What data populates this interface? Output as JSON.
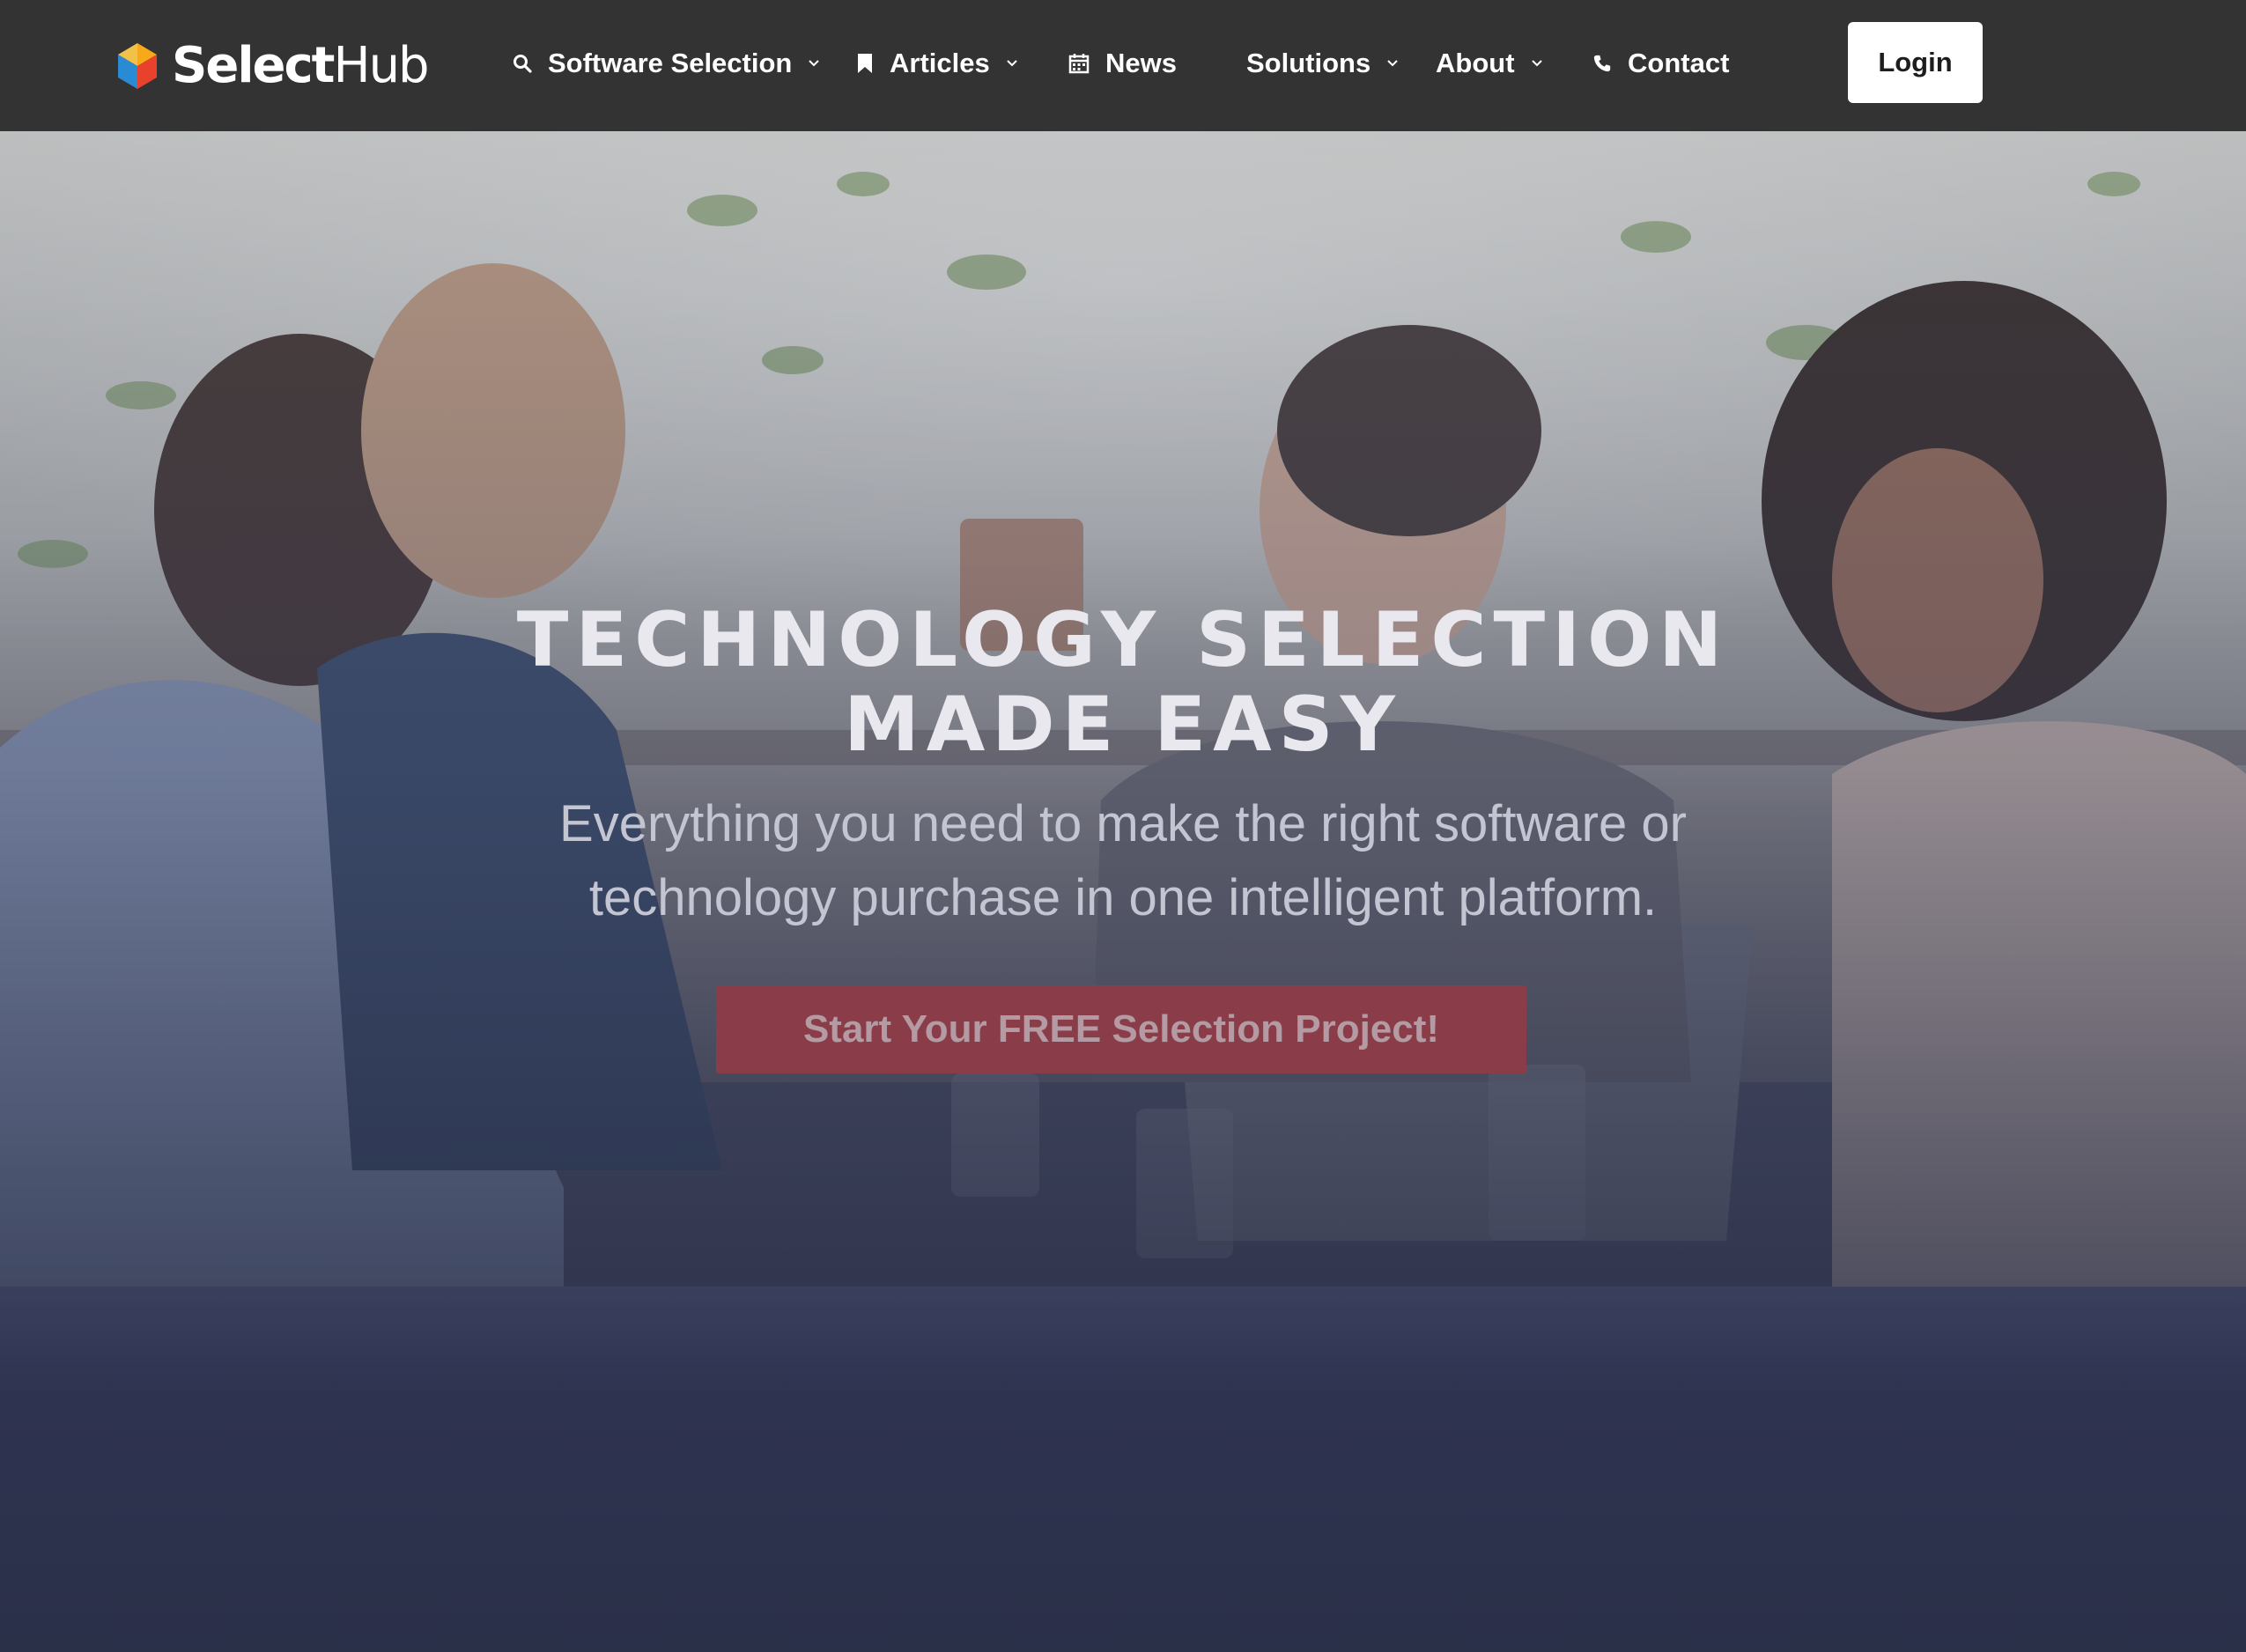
{
  "brand": {
    "name_bold": "Select",
    "name_regular": "Hub",
    "logo_colors": [
      "#f7a81b",
      "#e8412c",
      "#2a8ad4"
    ]
  },
  "nav": {
    "items": [
      {
        "label": "Software Selection",
        "icon": "search-icon",
        "has_dropdown": true
      },
      {
        "label": "Articles",
        "icon": "bookmark-icon",
        "has_dropdown": true
      },
      {
        "label": "News",
        "icon": "calendar-icon",
        "has_dropdown": false
      },
      {
        "label": "Solutions",
        "icon": "",
        "has_dropdown": true
      },
      {
        "label": "About",
        "icon": "",
        "has_dropdown": true
      },
      {
        "label": "Contact",
        "icon": "phone-icon",
        "has_dropdown": false
      }
    ],
    "login_label": "Login"
  },
  "hero": {
    "title_line1": "TECHNOLOGY SELECTION",
    "title_line2": "MADE EASY",
    "subtitle_line1": "Everything you need to make the right software or",
    "subtitle_line2": "technology purchase in one intelligent platform.",
    "cta_label": "Start Your FREE Selection Project!"
  },
  "colors": {
    "navbar_bg": "#333333",
    "cta_bg": "#8a3d48",
    "page_bg": "#2b3049"
  }
}
